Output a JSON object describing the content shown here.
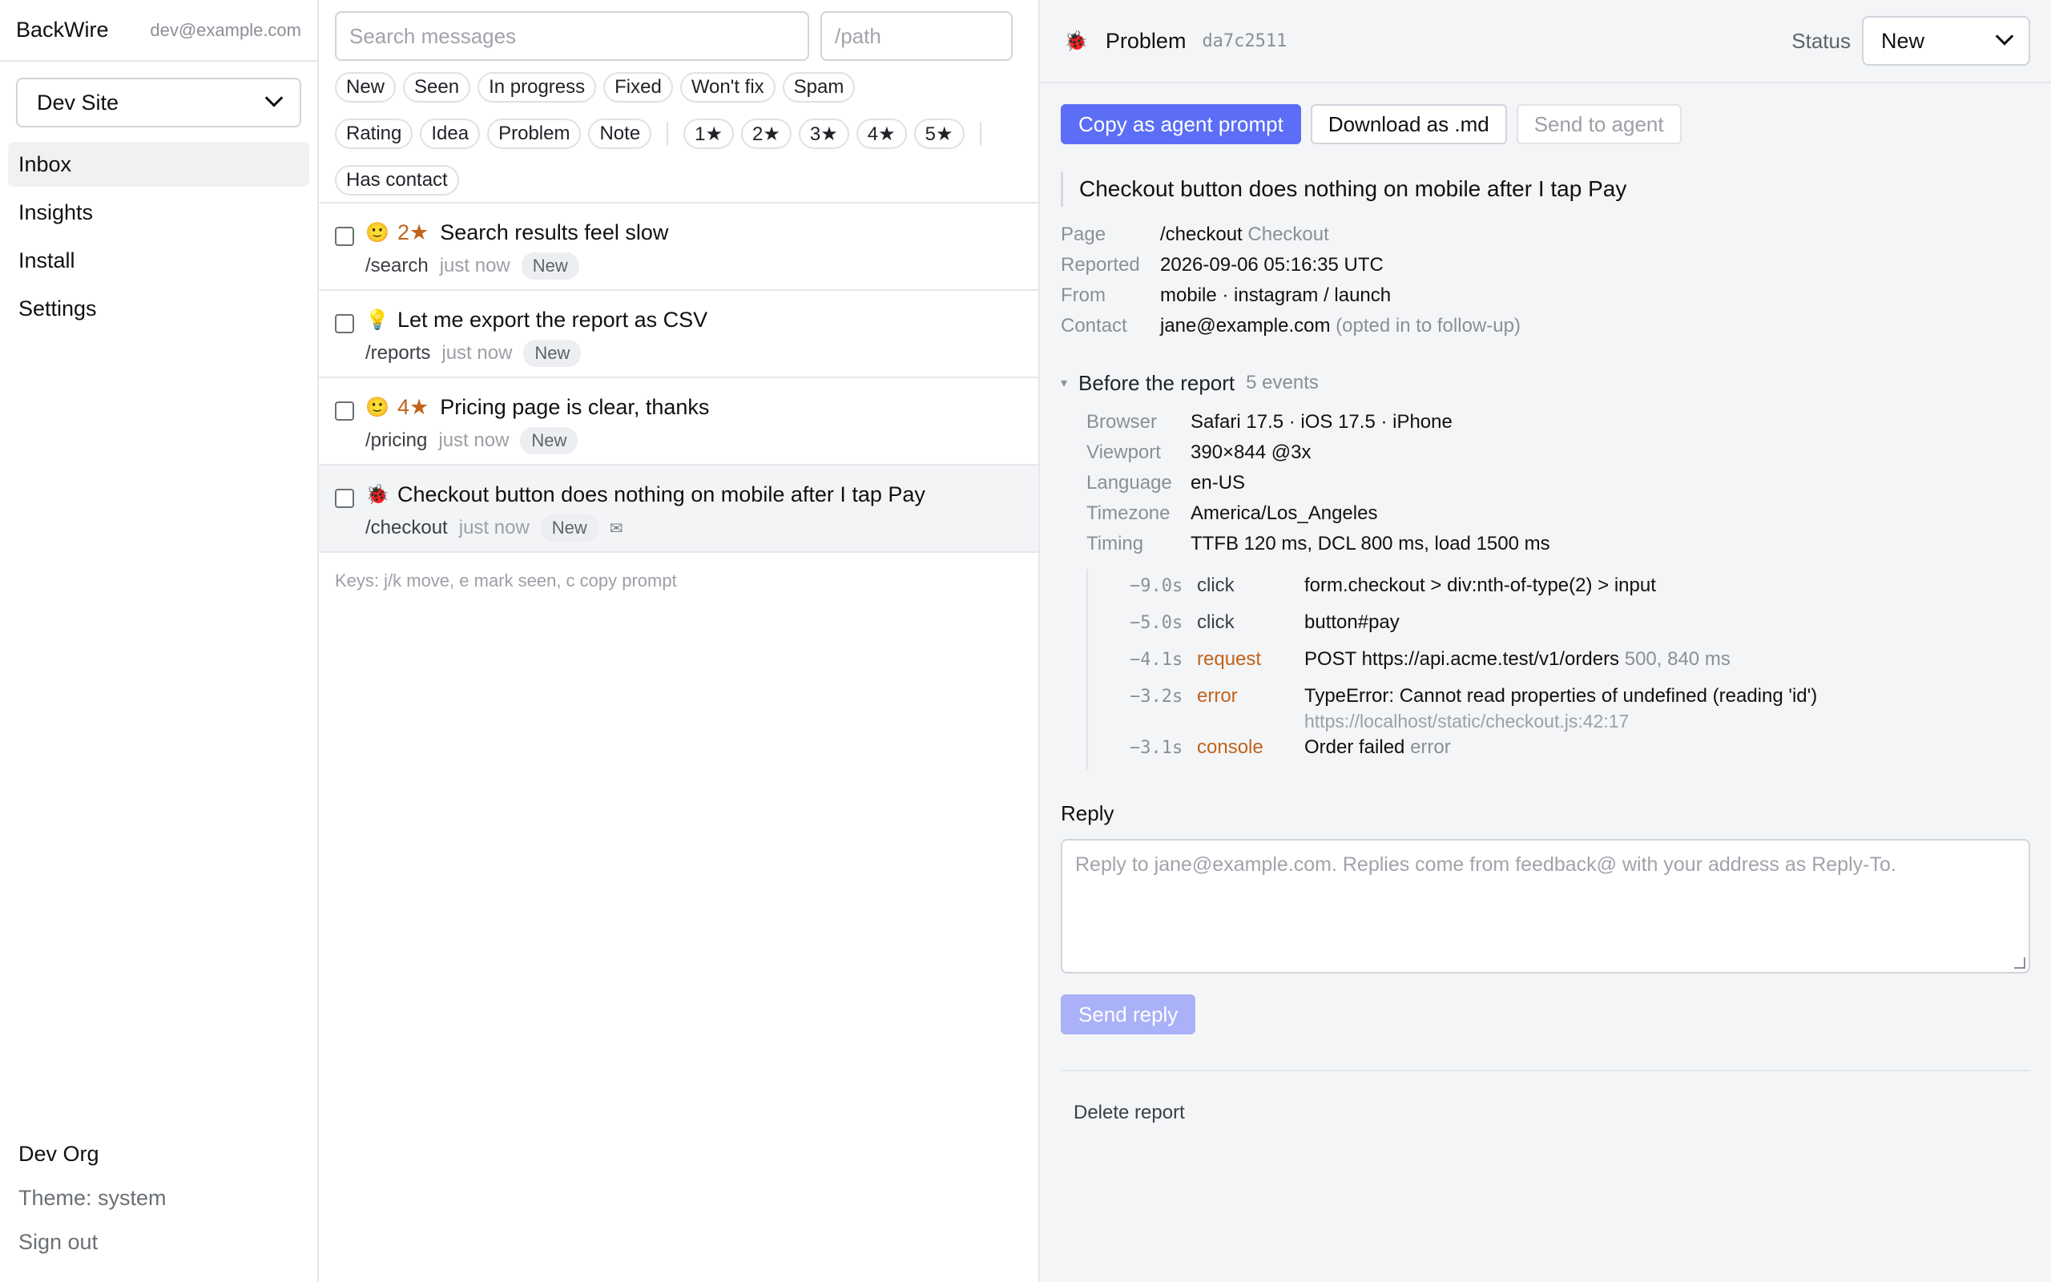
{
  "app": {
    "name": "BackWire",
    "user_email": "dev@example.com"
  },
  "sidebar": {
    "site_select": "Dev Site",
    "nav": [
      {
        "label": "Inbox",
        "active": true
      },
      {
        "label": "Insights"
      },
      {
        "label": "Install"
      },
      {
        "label": "Settings"
      }
    ],
    "footer": {
      "org": "Dev Org",
      "theme": "Theme: system",
      "sign_out": "Sign out"
    }
  },
  "list": {
    "search_placeholder": "Search messages",
    "path_placeholder": "/path",
    "status_filters": [
      "New",
      "Seen",
      "In progress",
      "Fixed",
      "Won't fix",
      "Spam"
    ],
    "type_filters": [
      "Rating",
      "Idea",
      "Problem",
      "Note"
    ],
    "rating_filters": [
      "1★",
      "2★",
      "3★",
      "4★",
      "5★"
    ],
    "contact_filter": "Has contact",
    "items": [
      {
        "icon": "smile-icon",
        "glyph": "🙂",
        "rating": "2★",
        "title": "Search results feel slow",
        "path": "/search",
        "time": "just now",
        "status": "New"
      },
      {
        "icon": "lightbulb-icon",
        "glyph": "💡",
        "rating": "",
        "title": "Let me export the report as CSV",
        "path": "/reports",
        "time": "just now",
        "status": "New"
      },
      {
        "icon": "smile-icon",
        "glyph": "🙂",
        "rating": "4★",
        "title": "Pricing page is clear, thanks",
        "path": "/pricing",
        "time": "just now",
        "status": "New"
      },
      {
        "icon": "bug-icon",
        "glyph": "🐞",
        "rating": "",
        "title": "Checkout button does nothing on mobile after I tap Pay",
        "path": "/checkout",
        "time": "just now",
        "status": "New",
        "mail": "✉",
        "selected": true
      }
    ],
    "keys_hint": "Keys: j/k move, e mark seen, c copy prompt"
  },
  "detail": {
    "type_glyph": "🐞",
    "type": "Problem",
    "report_id": "da7c2511",
    "status_label": "Status",
    "status_value": "New",
    "buttons": {
      "copy": "Copy as agent prompt",
      "download": "Download as .md",
      "send_agent": "Send to agent"
    },
    "message": "Checkout button does nothing on mobile after I tap Pay",
    "fields": {
      "page_key": "Page",
      "page_path": "/checkout",
      "page_title": "Checkout",
      "reported_key": "Reported",
      "reported_val": "2026-09-06 05:16:35 UTC",
      "from_key": "From",
      "from_val": "mobile · instagram / launch",
      "contact_key": "Contact",
      "contact_val": "jane@example.com",
      "contact_note": "(opted in to follow-up)"
    },
    "before": {
      "label": "Before the report",
      "count": "5 events"
    },
    "context": [
      {
        "key": "Browser",
        "val": "Safari 17.5 · iOS 17.5 · iPhone"
      },
      {
        "key": "Viewport",
        "val": "390×844 @3x"
      },
      {
        "key": "Language",
        "val": "en-US"
      },
      {
        "key": "Timezone",
        "val": "America/Los_Angeles"
      },
      {
        "key": "Timing",
        "val": "TTFB 120 ms, DCL 800 ms, load 1500 ms"
      }
    ],
    "events": [
      {
        "t": "−9.0s",
        "kind": "click",
        "desc": "form.checkout > div:nth-of-type(2) > input",
        "extra": "",
        "sub": ""
      },
      {
        "t": "−5.0s",
        "kind": "click",
        "desc": "button#pay",
        "extra": "",
        "sub": ""
      },
      {
        "t": "−4.1s",
        "kind": "request",
        "desc": "POST https://api.acme.test/v1/orders",
        "extra": "500, 840 ms",
        "sub": ""
      },
      {
        "t": "−3.2s",
        "kind": "error",
        "desc": "TypeError: Cannot read properties of undefined (reading 'id')",
        "extra": "",
        "sub": "https://localhost/static/checkout.js:42:17"
      },
      {
        "t": "−3.1s",
        "kind": "console",
        "desc": "Order failed",
        "extra": "error",
        "sub": ""
      }
    ],
    "reply": {
      "label": "Reply",
      "placeholder": "Reply to jane@example.com. Replies come from feedback@ with your address as Reply-To.",
      "send": "Send reply"
    },
    "delete": "Delete report"
  },
  "colors": {
    "accent": "#5b6ef5",
    "accent_disabled": "#a9b1f8",
    "warn": "#c0631b"
  }
}
